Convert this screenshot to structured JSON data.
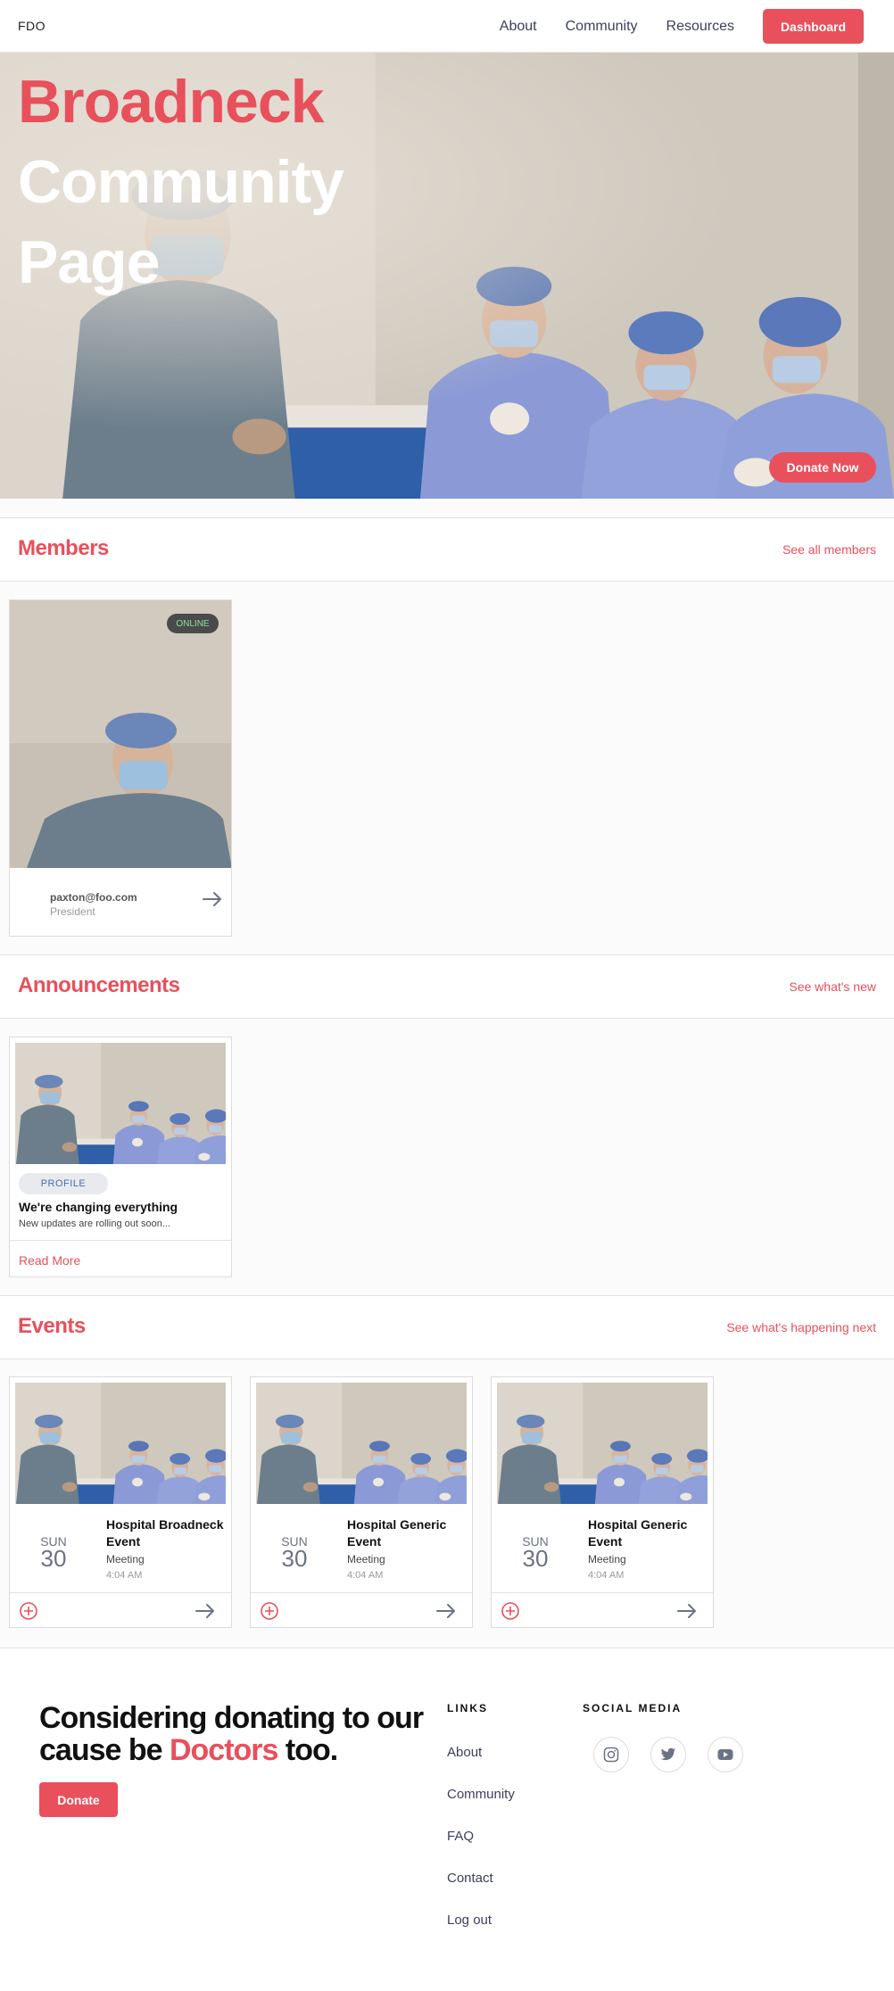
{
  "nav": {
    "brand": "FDO",
    "links": [
      "About",
      "Community",
      "Resources"
    ],
    "dashboard": "Dashboard"
  },
  "hero": {
    "title_line1": "Broadneck",
    "title_line2": "Community",
    "title_line3": "Page",
    "donate_now": "Donate Now"
  },
  "members": {
    "title": "Members",
    "link": "See all members",
    "cards": [
      {
        "status": "ONLINE",
        "email": "paxton@foo.com",
        "role": "President"
      }
    ]
  },
  "announcements": {
    "title": "Announcements",
    "link": "See what's new",
    "cards": [
      {
        "tag": "PROFILE",
        "title": "We're changing everything",
        "description": "New updates are rolling out soon...",
        "read_more": "Read More"
      }
    ]
  },
  "events": {
    "title": "Events",
    "link": "See what's happening next",
    "cards": [
      {
        "day": "SUN",
        "date": "30",
        "title": "Hospital Broadneck Event",
        "type": "Meeting",
        "time": "4:04 AM"
      },
      {
        "day": "SUN",
        "date": "30",
        "title": "Hospital Generic Event",
        "type": "Meeting",
        "time": "4:04 AM"
      },
      {
        "day": "SUN",
        "date": "30",
        "title": "Hospital Generic Event",
        "type": "Meeting",
        "time": "4:04 AM"
      }
    ]
  },
  "footer": {
    "cta_part1": "Considering donating to our cause be ",
    "cta_accent": "Doctors",
    "cta_part2": " too.",
    "donate": "Donate",
    "links_heading": "LINKS",
    "links": [
      "About",
      "Community",
      "FAQ",
      "Contact",
      "Log out"
    ],
    "social_heading": "SOCIAL MEDIA",
    "social_icons": [
      "instagram-icon",
      "twitter-icon",
      "youtube-icon"
    ]
  },
  "colors": {
    "accent": "#e8505b",
    "nav_text": "#3b3f5c",
    "online_badge_text": "#8be0a4"
  }
}
